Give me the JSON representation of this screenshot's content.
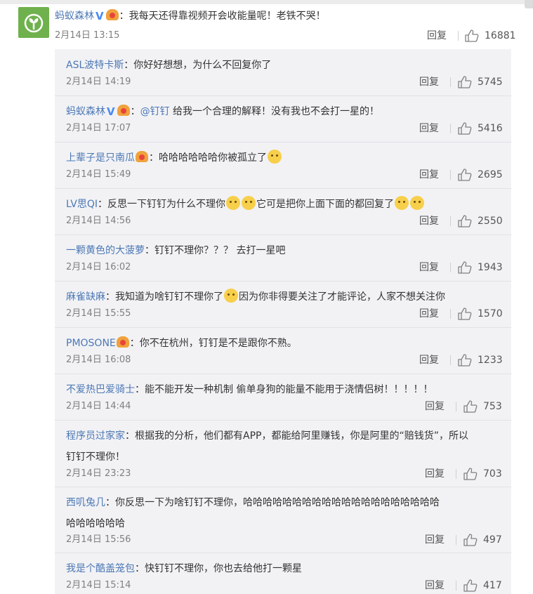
{
  "main_comment": {
    "user": "蚂蚁森林",
    "verified_mark": "V",
    "text": "：我每天还得靠视频开会收能量呢！老铁不哭！",
    "date": "2月14日 13:15",
    "reply_label": "回复",
    "likes": "16881"
  },
  "replies": [
    {
      "user": "ASL波特卡斯",
      "text": "：你好好想想，为什么不回复你了",
      "date": "2月14日 14:19",
      "reply_label": "回复",
      "likes": "5745"
    },
    {
      "user": "蚂蚁森林",
      "verified_mark": "V",
      "mention": "@钉钉",
      "text": " 给我一个合理的解释！没有我也不会打一星的！",
      "date": "2月14日 17:07",
      "reply_label": "回复",
      "likes": "5416"
    },
    {
      "user": "上辈子是只南瓜",
      "text": "：哈哈哈哈哈哈你被孤立了",
      "date": "2月14日 15:49",
      "reply_label": "回复",
      "likes": "2695"
    },
    {
      "user": "LV思QI",
      "text1": "：反思一下钉钉为什么不理你",
      "text2": "它可是把你上面下面的都回复了",
      "date": "2月14日 14:56",
      "reply_label": "回复",
      "likes": "2550"
    },
    {
      "user": "一颗黄色的大菠萝",
      "text": "：钉钉不理你？？？ 去打一星吧",
      "date": "2月14日 16:02",
      "reply_label": "回复",
      "likes": "1943"
    },
    {
      "user": "麻雀缺麻",
      "text1": "：我知道为啥钉钉不理你了",
      "text2": "因为你非得要关注了才能评论，人家不想关注你",
      "date": "2月14日 15:55",
      "reply_label": "回复",
      "likes": "1570"
    },
    {
      "user": "PMOSONE",
      "text": "：你不在杭州，钉钉是不是跟你不熟。",
      "date": "2月14日 16:08",
      "reply_label": "回复",
      "likes": "1233"
    },
    {
      "user": "不爱热巴爱骑士",
      "text": "：能不能开发一种机制 偷单身狗的能量不能用于浇情侣树！！！！！",
      "date": "2月14日 14:44",
      "reply_label": "回复",
      "likes": "753"
    },
    {
      "user": "程序员过家家",
      "text1": "：根据我的分析，他们都有APP，都能给阿里赚钱，你是阿里的“赔钱货”，所以",
      "text2": "钉钉不理你！",
      "date": "2月14日 23:23",
      "reply_label": "回复",
      "likes": "703"
    },
    {
      "user": "西叽兔几",
      "text1": "：你反思一下为啥钉钉不理你，哈哈哈哈哈哈哈哈哈哈哈哈哈哈哈哈哈哈哈哈",
      "text2": "哈哈哈哈哈哈",
      "date": "2月14日 15:56",
      "reply_label": "回复",
      "likes": "497"
    },
    {
      "user": "我是个酷盖笼包",
      "text": "：快钉钉不理你，你也去给他打一颗星",
      "date": "2月14日 15:14",
      "reply_label": "回复",
      "likes": "417"
    }
  ]
}
